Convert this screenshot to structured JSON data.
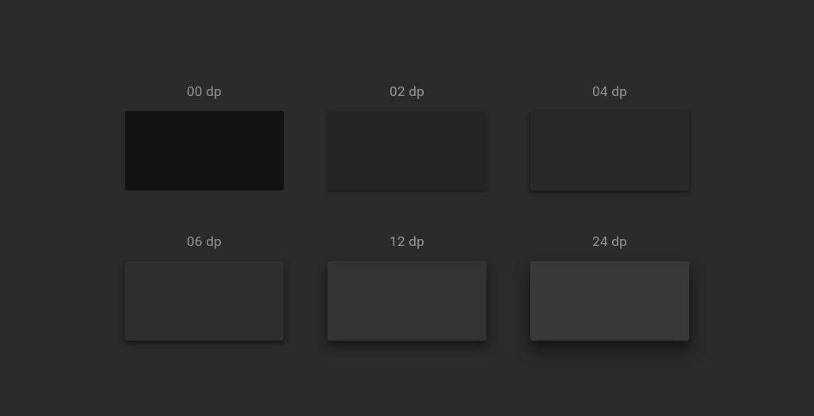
{
  "swatches": [
    {
      "label": "00 dp",
      "color": "#121212",
      "elevation": 0
    },
    {
      "label": "02 dp",
      "color": "#242424",
      "elevation": 2
    },
    {
      "label": "04 dp",
      "color": "#292929",
      "elevation": 4
    },
    {
      "label": "06 dp",
      "color": "#2e2e2e",
      "elevation": 6
    },
    {
      "label": "12 dp",
      "color": "#333333",
      "elevation": 12
    },
    {
      "label": "24 dp",
      "color": "#383838",
      "elevation": 24
    }
  ],
  "background": "#2a2a2a"
}
